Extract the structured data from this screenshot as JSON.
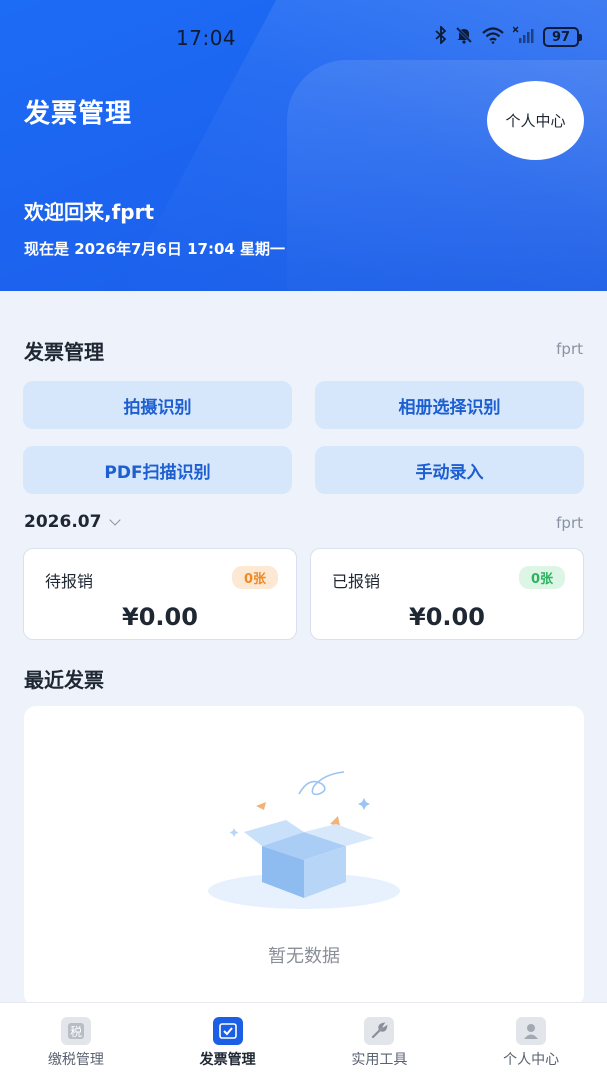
{
  "status_bar": {
    "time": "17:04",
    "battery": "97",
    "icons": [
      "bluetooth-icon",
      "mute-bell-icon",
      "wifi-icon",
      "signal-icon",
      "battery-icon"
    ]
  },
  "header": {
    "title": "发票管理",
    "profile_label": "个人中心",
    "welcome": "欢迎回来,fprt",
    "datetime": "现在是 2026年7月6日 17:04 星期一"
  },
  "invoice_section": {
    "title": "发票管理",
    "user": "fprt",
    "actions": [
      {
        "label": "拍摄识别"
      },
      {
        "label": "相册选择识别"
      },
      {
        "label": "PDF扫描识别"
      },
      {
        "label": "手动录入"
      }
    ]
  },
  "summary": {
    "month": "2026.07",
    "user": "fprt",
    "pending": {
      "label": "待报销",
      "count": "0张",
      "amount": "¥0.00"
    },
    "reimbursed": {
      "label": "已报销",
      "count": "0张",
      "amount": "¥0.00"
    }
  },
  "recent": {
    "title": "最近发票",
    "empty_text": "暂无数据"
  },
  "bottom_nav": {
    "items": [
      {
        "label": "缴税管理",
        "icon": "tax-icon",
        "active": false
      },
      {
        "label": "发票管理",
        "icon": "invoice-check-icon",
        "active": true
      },
      {
        "label": "实用工具",
        "icon": "wrench-icon",
        "active": false
      },
      {
        "label": "个人中心",
        "icon": "user-icon",
        "active": false
      }
    ]
  },
  "colors": {
    "brand_blue": "#1d6cf5",
    "button_bg": "#d6e6fb",
    "button_text": "#1d5fd0",
    "badge_orange": "#f08a24",
    "badge_green": "#2bb360"
  }
}
